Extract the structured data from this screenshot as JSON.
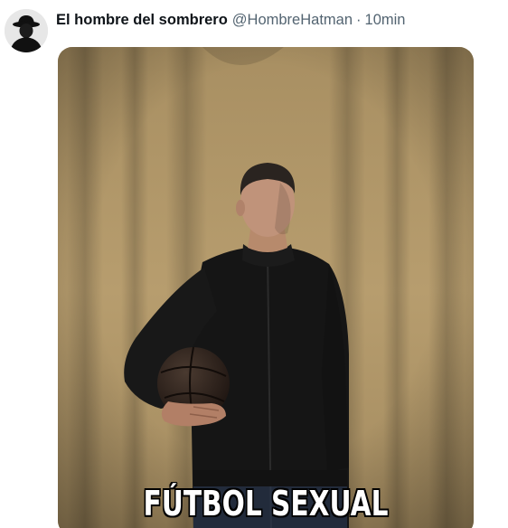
{
  "tweet": {
    "author": {
      "display_name": "El hombre del sombrero",
      "handle": "@HombreHatman",
      "avatar_icon": "hat-silhouette-icon"
    },
    "separator": "·",
    "timestamp": "10min",
    "media": {
      "caption": "FÚTBOL SEXUAL",
      "colors": {
        "backdrop": "#b49a6a",
        "jacket": "#1a1a1a",
        "ball": "#2e221c"
      }
    }
  }
}
